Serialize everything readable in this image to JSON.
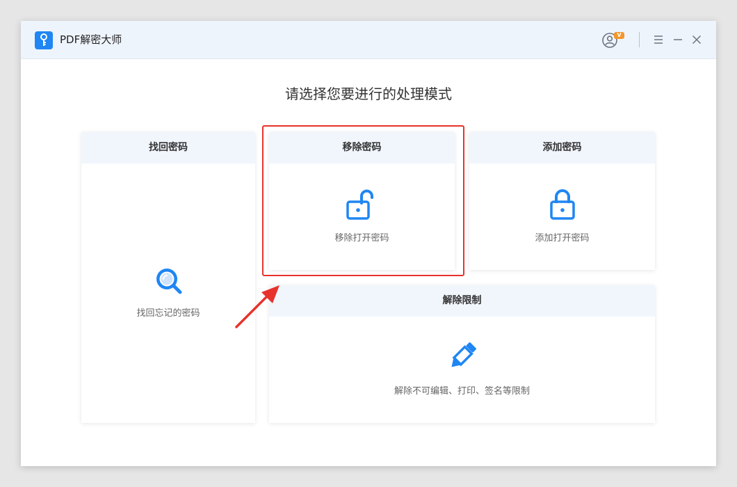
{
  "app": {
    "title": "PDF解密大师",
    "vip_badge": "V"
  },
  "titlebar": {
    "icons": [
      "user-avatar-icon",
      "menu-icon",
      "minimize-icon",
      "close-icon"
    ]
  },
  "heading": "请选择您要进行的处理模式",
  "cards": {
    "recover": {
      "title": "找回密码",
      "desc": "找回忘记的密码",
      "icon": "magnifier-icon"
    },
    "remove": {
      "title": "移除密码",
      "desc": "移除打开密码",
      "icon": "unlocked-padlock-icon"
    },
    "add": {
      "title": "添加密码",
      "desc": "添加打开密码",
      "icon": "padlock-icon"
    },
    "unlock": {
      "title": "解除限制",
      "desc": "解除不可编辑、打印、签名等限制",
      "icon": "pencil-icon"
    }
  },
  "colors": {
    "accent": "#1f86f3",
    "highlight": "#e8322c",
    "vip": "#f3962b"
  }
}
